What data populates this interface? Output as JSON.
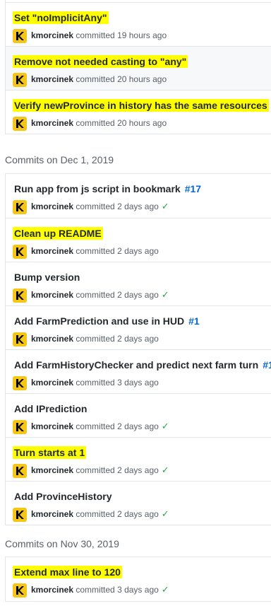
{
  "groups": [
    {
      "header": "",
      "commits": [
        {
          "title": "Set \"noImplicitAny\"",
          "issue": "",
          "author": "kmorcinek",
          "action": "committed",
          "time": "19 hours ago",
          "status": "",
          "highlighted": true
        },
        {
          "title": "Remove not needed casting to \"any\"",
          "issue": "",
          "author": "kmorcinek",
          "action": "committed",
          "time": "20 hours ago",
          "status": "",
          "highlighted": true
        },
        {
          "title": "Verify newProvince in history has the same resources",
          "issue": "",
          "author": "kmorcinek",
          "action": "committed",
          "time": "20 hours ago",
          "status": "",
          "highlighted": true
        }
      ]
    },
    {
      "header": "Commits on Dec 1, 2019",
      "commits": [
        {
          "title": "Run app from js script in bookmark",
          "issue": "#17",
          "author": "kmorcinek",
          "action": "committed",
          "time": "2 days ago",
          "status": "success",
          "highlighted": false
        },
        {
          "title": "Clean up README",
          "issue": "",
          "author": "kmorcinek",
          "action": "committed",
          "time": "2 days ago",
          "status": "",
          "highlighted": true
        },
        {
          "title": "Bump version",
          "issue": "",
          "author": "kmorcinek",
          "action": "committed",
          "time": "2 days ago",
          "status": "success",
          "highlighted": false
        },
        {
          "title": "Add FarmPrediction and use in HUD",
          "issue": "#1",
          "author": "kmorcinek",
          "action": "committed",
          "time": "2 days ago",
          "status": "",
          "highlighted": false
        },
        {
          "title": "Add FarmHistoryChecker and predict next farm turn",
          "issue": "#1",
          "author": "kmorcinek",
          "action": "committed",
          "time": "3 days ago",
          "status": "",
          "highlighted": false
        },
        {
          "title": "Add IPrediction",
          "issue": "",
          "author": "kmorcinek",
          "action": "committed",
          "time": "2 days ago",
          "status": "success",
          "highlighted": false
        },
        {
          "title": "Turn starts at 1",
          "issue": "",
          "author": "kmorcinek",
          "action": "committed",
          "time": "2 days ago",
          "status": "success",
          "highlighted": true
        },
        {
          "title": "Add ProvinceHistory",
          "issue": "",
          "author": "kmorcinek",
          "action": "committed",
          "time": "2 days ago",
          "status": "success",
          "highlighted": false
        }
      ]
    },
    {
      "header": "Commits on Nov 30, 2019",
      "commits": [
        {
          "title": "Extend max line to 120",
          "issue": "",
          "author": "kmorcinek",
          "action": "committed",
          "time": "3 days ago",
          "status": "success",
          "highlighted": true
        }
      ]
    }
  ],
  "icons": {
    "avatar": "kmorcinek-avatar",
    "status_success": "check-icon"
  },
  "colors": {
    "highlight": "#ffff00",
    "avatar_bg": "#f5c518",
    "success": "#28a745",
    "issue_link": "#0366d6"
  }
}
